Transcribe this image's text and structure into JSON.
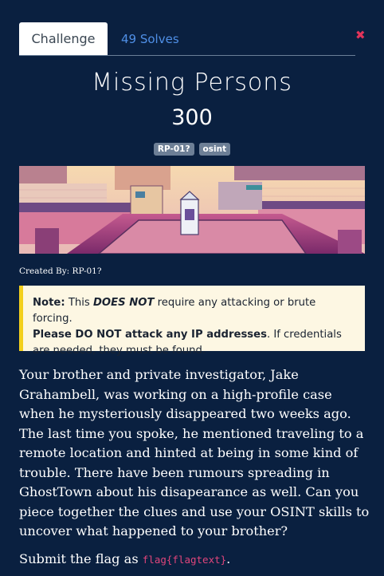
{
  "tabs": {
    "challenge": "Challenge",
    "solves": "49 Solves"
  },
  "close_icon": "close-x-icon",
  "challenge": {
    "title": "Missing Persons",
    "points": "300",
    "tags": [
      "RP-01?",
      "osint"
    ],
    "created_by": "Created By: RP-01?"
  },
  "note": {
    "label": "Note:",
    "t1": " This ",
    "em": "DOES NOT",
    "t2": " require any attacking or brute forcing.",
    "strong2": "Please DO NOT attack any IP addresses",
    "t3": ". If credentials are needed, they must be found."
  },
  "description": "Your brother and private investigator, Jake Grahambell, was working on a high-profile case when he mysteriously disappeared two weeks ago. The last time you spoke, he mentioned traveling to a remote location and hinted at being in some kind of trouble. There have been rumours spreading in GhostTown about his disapearance as well. Can you piece together the clues and use your OSINT skills to uncover what happened to your brother?",
  "submit": {
    "prefix": "Submit the flag as ",
    "flag": "flag{flagtext}",
    "suffix": "."
  },
  "colors": {
    "background": "#0a2040",
    "tab_link": "#4f8fe6",
    "close": "#e1345a",
    "note_border": "#f2cf1e",
    "flag": "#e0457b"
  }
}
